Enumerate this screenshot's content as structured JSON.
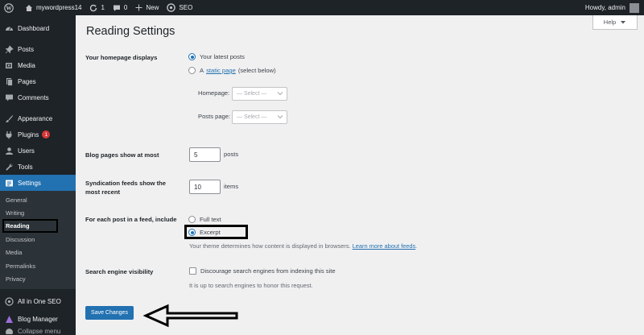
{
  "adminbar": {
    "site_name": "mywordpress14",
    "updates_count": "1",
    "comments_count": "0",
    "new_label": "New",
    "seo_label": "SEO",
    "howdy": "Howdy, admin"
  },
  "sidebar": {
    "items": [
      {
        "label": "Dashboard",
        "icon": "dashboard-icon"
      },
      {
        "label": "Posts",
        "icon": "pin-icon"
      },
      {
        "label": "Media",
        "icon": "media-icon"
      },
      {
        "label": "Pages",
        "icon": "page-icon"
      },
      {
        "label": "Comments",
        "icon": "comment-icon"
      },
      {
        "label": "Appearance",
        "icon": "brush-icon"
      },
      {
        "label": "Plugins",
        "icon": "plug-icon",
        "badge": "1"
      },
      {
        "label": "Users",
        "icon": "user-icon"
      },
      {
        "label": "Tools",
        "icon": "wrench-icon"
      },
      {
        "label": "Settings",
        "icon": "settings-icon"
      }
    ],
    "submenu": [
      "General",
      "Writing",
      "Reading",
      "Discussion",
      "Media",
      "Permalinks",
      "Privacy"
    ],
    "after_items": [
      {
        "label": "All in One SEO",
        "icon": "aioseo-icon"
      },
      {
        "label": "Blog Manager",
        "icon": "blog-manager-icon"
      },
      {
        "label": "Collapse menu"
      }
    ]
  },
  "main": {
    "help_label": "Help",
    "title": "Reading Settings",
    "homepage": {
      "label": "Your homepage displays",
      "option_latest": "Your latest posts",
      "option_static_prefix": "A",
      "option_static_link": "static page",
      "option_static_suffix": "(select below)",
      "homepage_label": "Homepage:",
      "posts_page_label": "Posts page:",
      "select_placeholder": "— Select —",
      "selected": "latest"
    },
    "blog_pages": {
      "label": "Blog pages show at most",
      "value": "5",
      "unit": "posts"
    },
    "syndication": {
      "label_line1": "Syndication feeds show the",
      "label_line2": "most recent",
      "value": "10",
      "unit": "items"
    },
    "feed": {
      "label": "For each post in a feed, include",
      "option_full": "Full text",
      "option_excerpt": "Excerpt",
      "selected": "excerpt",
      "desc": "Your theme determines how content is displayed in browsers.",
      "desc_link": "Learn more about feeds"
    },
    "search": {
      "label": "Search engine visibility",
      "checkbox_label": "Discourage search engines from indexing this site",
      "checked": false,
      "desc": "It is up to search engines to honor this request."
    },
    "save_label": "Save Changes"
  }
}
